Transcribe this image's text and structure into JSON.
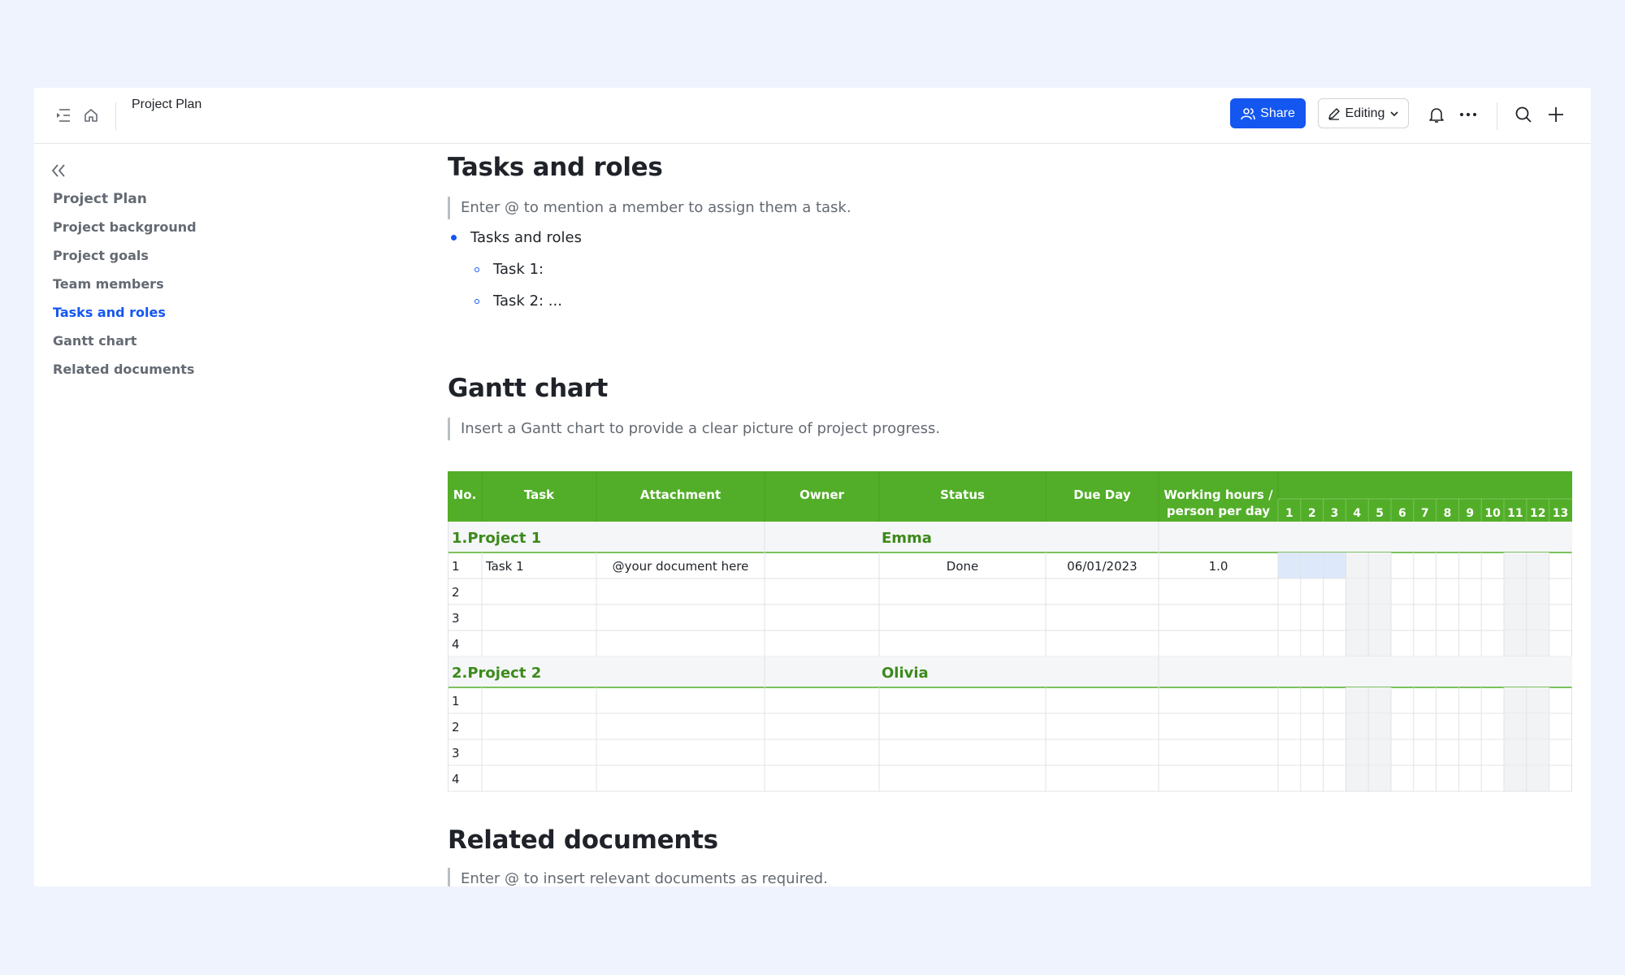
{
  "header": {
    "doc_title": "Project Plan",
    "share_label": "Share",
    "editing_label": "Editing"
  },
  "sidebar": {
    "items": [
      {
        "label": "Project Plan"
      },
      {
        "label": "Project background"
      },
      {
        "label": "Project goals"
      },
      {
        "label": "Team members"
      },
      {
        "label": "Tasks and roles",
        "active": true
      },
      {
        "label": "Gantt chart"
      },
      {
        "label": "Related documents"
      }
    ]
  },
  "sections": {
    "tasks": {
      "heading": "Tasks and roles",
      "hint": "Enter @ to mention a member to assign them a task.",
      "bullet": "Tasks and roles",
      "sub1": "Task 1:",
      "sub2": "Task 2: ..."
    },
    "gantt": {
      "heading": "Gantt chart",
      "hint": "Insert a Gantt chart to provide a clear picture of project progress."
    },
    "related": {
      "heading": "Related documents",
      "hint": "Enter @ to insert relevant documents as required."
    }
  },
  "table": {
    "headers": [
      "No.",
      "Task",
      "Attachment",
      "Owner",
      "Status",
      "Due Day",
      "Working hours /",
      "person per day"
    ],
    "days": [
      "1",
      "2",
      "3",
      "4",
      "5",
      "6",
      "7",
      "8",
      "9",
      "10",
      "11",
      "12",
      "13"
    ],
    "groups": [
      {
        "title": "1.Project 1",
        "owner": "Emma",
        "rows": [
          {
            "no": "1",
            "task": "Task 1",
            "attachment": "@your document here",
            "owner": "",
            "status": "Done",
            "due": "06/01/2023",
            "hours": "1.0",
            "highlighted_days": [
              1,
              2,
              3
            ]
          },
          {
            "no": "2",
            "task": "",
            "attachment": "",
            "owner": "",
            "status": "",
            "due": "",
            "hours": "",
            "highlighted_days": []
          },
          {
            "no": "3",
            "task": "",
            "attachment": "",
            "owner": "",
            "status": "",
            "due": "",
            "hours": "",
            "highlighted_days": []
          },
          {
            "no": "4",
            "task": "",
            "attachment": "",
            "owner": "",
            "status": "",
            "due": "",
            "hours": "",
            "highlighted_days": []
          }
        ]
      },
      {
        "title": "2.Project 2",
        "owner": "Olivia",
        "rows": [
          {
            "no": "1",
            "task": "",
            "attachment": "",
            "owner": "",
            "status": "",
            "due": "",
            "hours": "",
            "highlighted_days": []
          },
          {
            "no": "2",
            "task": "",
            "attachment": "",
            "owner": "",
            "status": "",
            "due": "",
            "hours": "",
            "highlighted_days": []
          },
          {
            "no": "3",
            "task": "",
            "attachment": "",
            "owner": "",
            "status": "",
            "due": "",
            "hours": "",
            "highlighted_days": []
          },
          {
            "no": "4",
            "task": "",
            "attachment": "",
            "owner": "",
            "status": "",
            "due": "",
            "hours": "",
            "highlighted_days": []
          }
        ]
      }
    ],
    "colors": {
      "header_green": "#52ae28",
      "group_text_green": "#3c8a1b",
      "highlight_blue": "#dde8fb",
      "weekend_gray": "#f2f3f5"
    }
  }
}
